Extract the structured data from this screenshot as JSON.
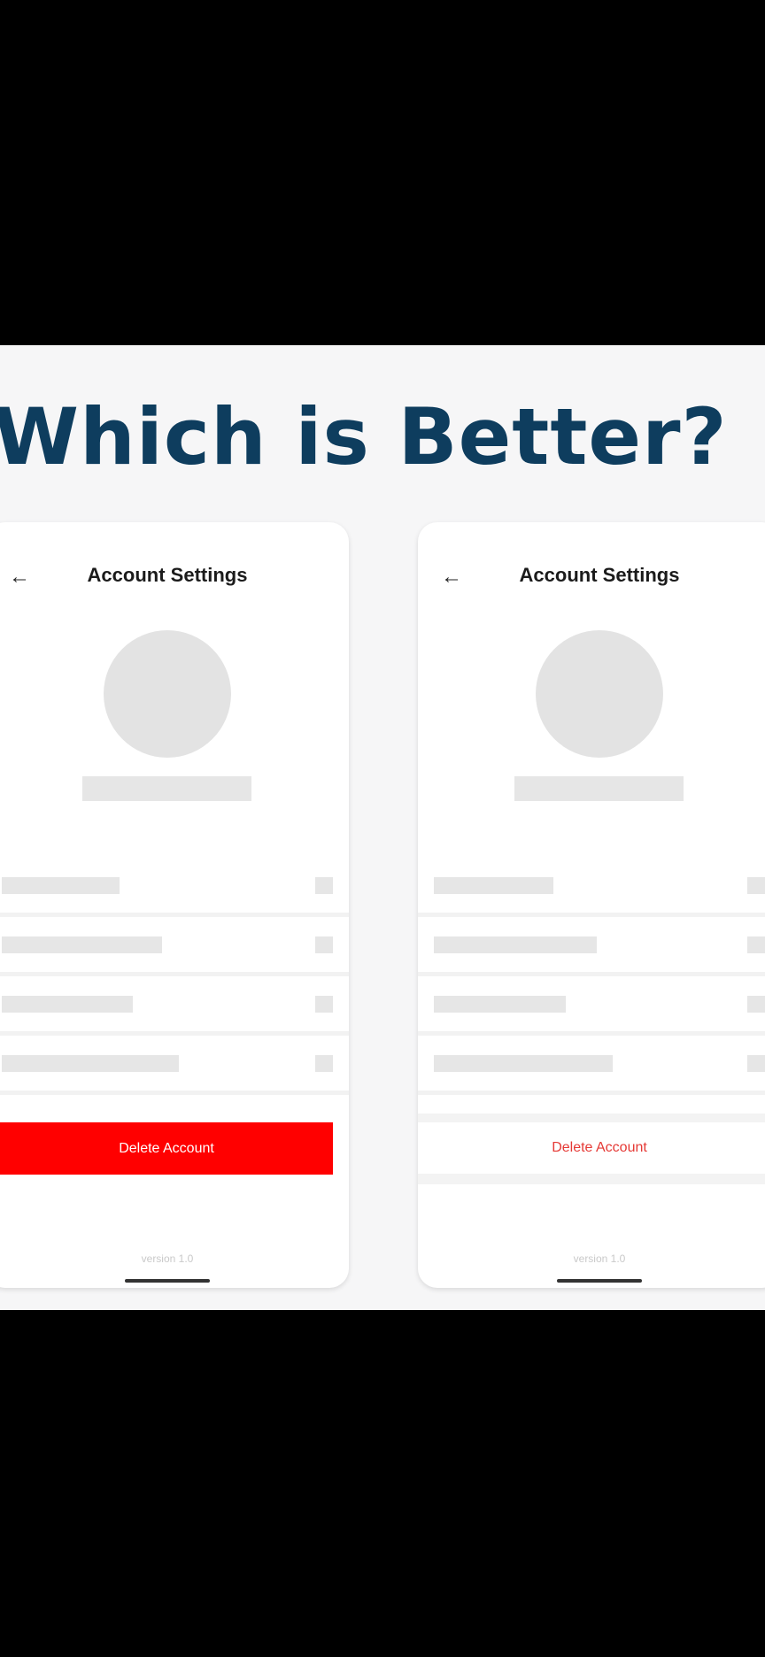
{
  "heading": "Which is Better?",
  "colors": {
    "title": "#0e3d5e",
    "danger": "#ff0000",
    "danger_text": "#e53935",
    "skeleton": "#e6e6e6"
  },
  "left_screen": {
    "back_icon": "arrow-left-icon",
    "title": "Account Settings",
    "delete_label": "Delete Account",
    "delete_style": "filled red button",
    "version": "version 1.0"
  },
  "right_screen": {
    "back_icon": "arrow-left-icon",
    "title": "Account Settings",
    "delete_label": "Delete Account",
    "delete_style": "plain red text row",
    "version": "version 1.0"
  }
}
